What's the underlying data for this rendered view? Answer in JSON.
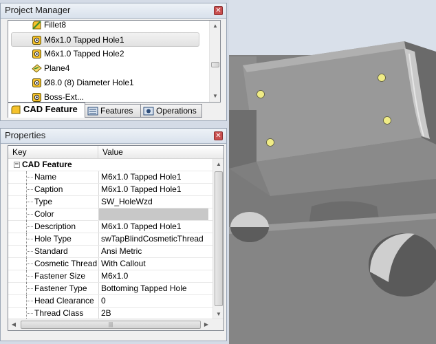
{
  "project_manager": {
    "title": "Project Manager",
    "items": [
      {
        "label": "Fillet8",
        "icon": "fillet-icon",
        "selected": false
      },
      {
        "label": "M6x1.0 Tapped Hole1",
        "icon": "hole-feature-icon",
        "selected": true
      },
      {
        "label": "M6x1.0 Tapped Hole2",
        "icon": "hole-feature-icon",
        "selected": false
      },
      {
        "label": "Plane4",
        "icon": "plane-icon",
        "selected": false
      },
      {
        "label": "Ø8.0 (8) Diameter Hole1",
        "icon": "hole-feature-icon",
        "selected": false
      },
      {
        "label": "Boss-Ext...",
        "icon": "hole-feature-icon",
        "selected": false
      }
    ],
    "tabs": [
      {
        "label": "CAD Feature",
        "icon": "cad-feature-icon",
        "active": true
      },
      {
        "label": "Features",
        "icon": "features-icon",
        "active": false
      },
      {
        "label": "Operations",
        "icon": "operations-icon",
        "active": false
      }
    ]
  },
  "properties": {
    "title": "Properties",
    "columns": {
      "key": "Key",
      "value": "Value"
    },
    "category": "CAD Feature",
    "rows": [
      {
        "key": "Name",
        "value": "M6x1.0 Tapped Hole1"
      },
      {
        "key": "Caption",
        "value": "M6x1.0 Tapped Hole1"
      },
      {
        "key": "Type",
        "value": "SW_HoleWzd"
      },
      {
        "key": "Color",
        "value": ""
      },
      {
        "key": "Description",
        "value": "M6x1.0 Tapped Hole1"
      },
      {
        "key": "Hole Type",
        "value": "swTapBlindCosmeticThread"
      },
      {
        "key": "Standard",
        "value": "Ansi Metric"
      },
      {
        "key": "Cosmetic Thread",
        "value": "With Callout"
      },
      {
        "key": "Fastener Size",
        "value": "M6x1.0"
      },
      {
        "key": "Fastener Type",
        "value": "Bottoming Tapped Hole"
      },
      {
        "key": "Head Clearance",
        "value": "0"
      },
      {
        "key": "Thread Class",
        "value": "2B"
      }
    ]
  },
  "colors": {
    "model_face": "#7c7c7c",
    "model_dark": "#5f5f5f",
    "model_light": "#a2a2a2",
    "hole_marker": "#f0ec86",
    "viewport_bg": "#d9e0ea"
  }
}
